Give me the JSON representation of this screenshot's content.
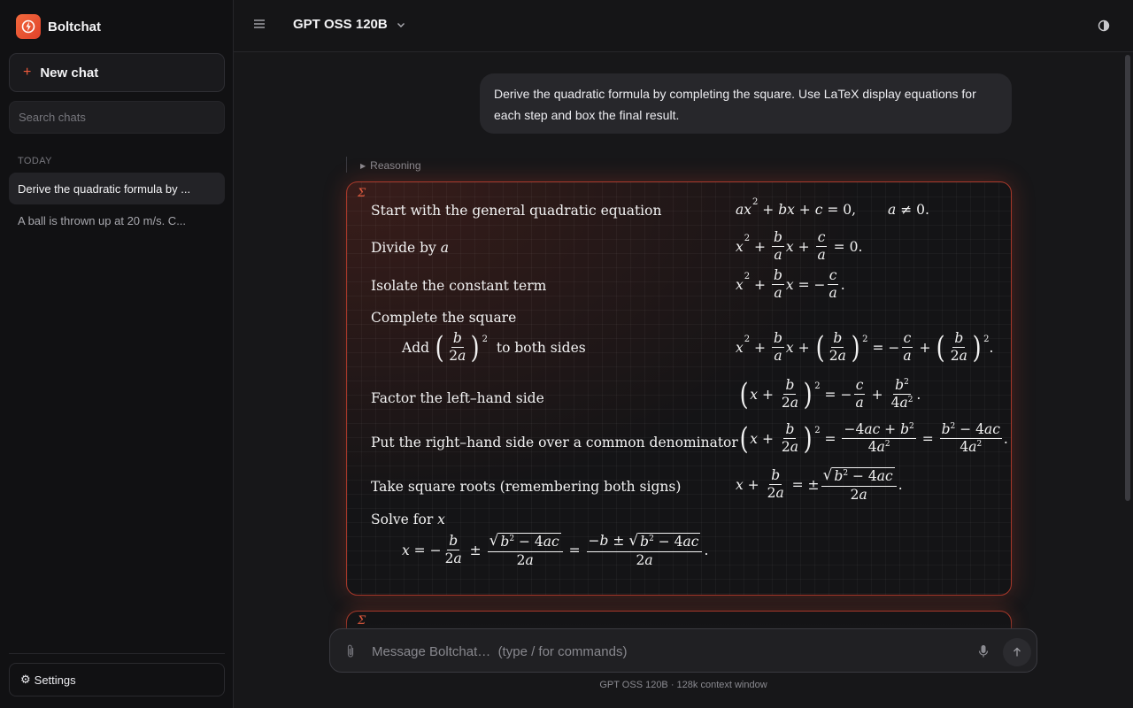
{
  "app": {
    "name": "Boltchat"
  },
  "sidebar": {
    "new_chat_label": "New chat",
    "search_placeholder": "Search chats",
    "section_label": "TODAY",
    "chats": [
      {
        "title": "Derive the quadratic formula by ...",
        "active": true
      },
      {
        "title": "A ball is thrown up at 20 m/s. C...",
        "active": false
      }
    ],
    "settings_label": "Settings"
  },
  "header": {
    "model": "GPT OSS 120B"
  },
  "conversation": {
    "user_message": "Derive the quadratic formula by completing the square. Use LaTeX display equations for each step and box the final result.",
    "reasoning_label": "Reasoning",
    "math_steps": [
      {
        "label": "Start with the general quadratic equation",
        "equation": "ax^2 + bx + c = 0, a ≠ 0."
      },
      {
        "label": "Divide by a",
        "equation": "x^2 + (b/a)x + c/a = 0."
      },
      {
        "label": "Isolate the constant term",
        "equation": "x^2 + (b/a)x = −c/a."
      },
      {
        "label": "Complete the square",
        "equation": ""
      },
      {
        "label": "Add (b/2a)^2 to both sides",
        "equation": "x^2 + (b/a)x + (b/2a)^2 = −c/a + (b/2a)^2."
      },
      {
        "label": "Factor the left–hand side",
        "equation": "(x + b/2a)^2 = −c/a + b^2/4a^2."
      },
      {
        "label": "Put the right–hand side over a common denominator",
        "equation": "(x + b/2a)^2 = (−4ac + b^2)/4a^2 = (b^2 − 4ac)/4a^2."
      },
      {
        "label": "Take square roots (remembering both signs)",
        "equation": "x + b/2a = ±√(b^2 − 4ac)/2a."
      },
      {
        "label": "Solve for x",
        "equation": "x = −b/2a ± √(b^2 − 4ac)/2a = (−b ± √(b^2 − 4ac))/2a."
      }
    ]
  },
  "composer": {
    "placeholder": "Message Boltchat…  (type / for commands)",
    "footer": "GPT OSS 120B · 128k context window"
  },
  "colors": {
    "accent": "#ef5a3c",
    "background": "#171719",
    "sidebar": "#111113"
  }
}
